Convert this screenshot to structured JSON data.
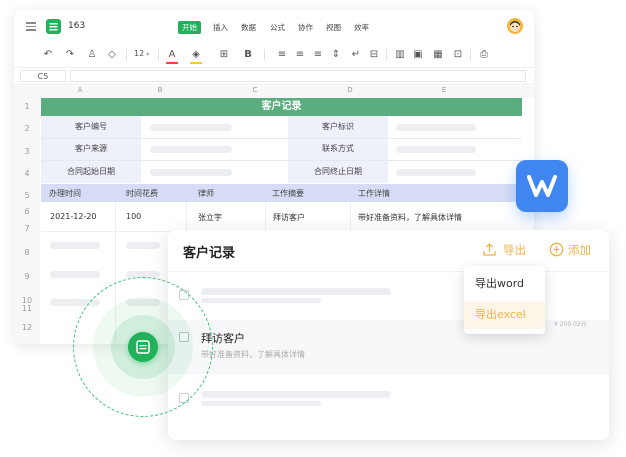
{
  "sheet": {
    "filename": "163",
    "menu": [
      "开始",
      "插入",
      "数据",
      "公式",
      "协作",
      "视图",
      "效率"
    ],
    "font_size": "12",
    "cell_ref": "C5",
    "col_letters": [
      "A",
      "B",
      "C",
      "D",
      "E"
    ],
    "row_numbers": [
      "1",
      "2",
      "3",
      "4",
      "5",
      "6",
      "7",
      "8",
      "9",
      "10",
      "11",
      "12"
    ],
    "title": "客户记录",
    "form": {
      "r2": [
        "客户编号",
        "客户标识"
      ],
      "r3": [
        "客户来源",
        "联系方式"
      ],
      "r4": [
        "合同起始日期",
        "合同终止日期"
      ]
    },
    "headers": [
      "办理时间",
      "时间花费",
      "律师",
      "工作摘要",
      "工作详情"
    ],
    "row6": [
      "2021-12-20",
      "100",
      "张立宇",
      "拜访客户",
      "带好准备资料，了解具体详情"
    ]
  },
  "card": {
    "title": "客户记录",
    "export_label": "导出",
    "add_label": "添加",
    "export_menu": [
      "导出word",
      "导出excel"
    ],
    "item_title": "拜访客户",
    "item_desc": "带好准备资料，了解具体详情",
    "amount": "¥ 200.02元"
  },
  "colors": {
    "green": "#21b15a",
    "title_bar": "#5aad7f",
    "header_row": "#d6dcf5",
    "form_label_bg": "#eef0fa",
    "orange": "#f0b24a",
    "wps_blue": "#3f86f0"
  }
}
